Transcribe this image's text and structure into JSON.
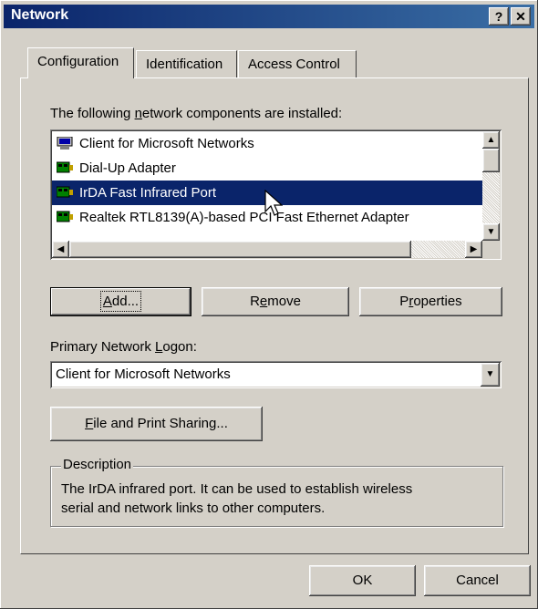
{
  "window": {
    "title": "Network",
    "help_btn": "?",
    "close_btn": "✕"
  },
  "tabs": [
    {
      "label": "Configuration"
    },
    {
      "label": "Identification"
    },
    {
      "label": "Access Control"
    }
  ],
  "components": {
    "label_pre": "The following ",
    "label_u": "n",
    "label_post": "etwork components are installed:",
    "items": [
      {
        "label": "Client for Microsoft Networks",
        "icon": "client-icon"
      },
      {
        "label": "Dial-Up Adapter",
        "icon": "adapter-icon"
      },
      {
        "label": "IrDA Fast Infrared Port",
        "icon": "adapter-icon",
        "selected": true
      },
      {
        "label": "Realtek RTL8139(A)-based PCI Fast Ethernet Adapter",
        "icon": "adapter-icon"
      }
    ]
  },
  "buttons": {
    "add_u": "A",
    "add_rest": "dd...",
    "remove_pre": "R",
    "remove_u": "e",
    "remove_post": "move",
    "properties_pre": "P",
    "properties_u": "r",
    "properties_post": "operties",
    "file_sharing_u": "F",
    "file_sharing_rest": "ile and Print Sharing...",
    "ok": "OK",
    "cancel": "Cancel"
  },
  "primary_logon": {
    "label_pre": "Primary Network ",
    "label_u": "L",
    "label_post": "ogon:",
    "value": "Client for Microsoft Networks"
  },
  "description": {
    "title": "Description",
    "line1": "The IrDA infrared port.  It can be used to establish wireless",
    "line2": "serial and network links to other computers."
  }
}
